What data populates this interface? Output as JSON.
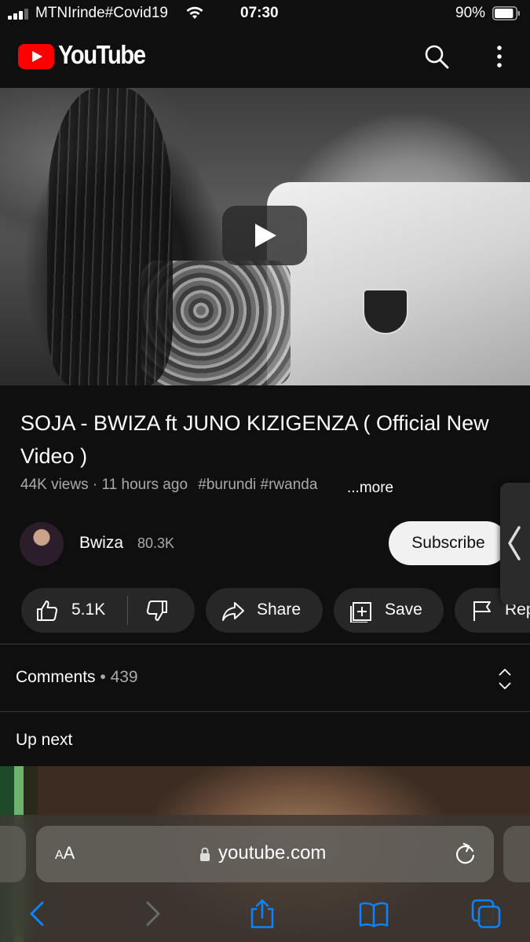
{
  "status_bar": {
    "carrier": "MTNIrinde#Covid19",
    "time": "07:30",
    "battery": "90%",
    "battery_level": 0.9
  },
  "header": {
    "brand": "YouTube",
    "icons": [
      "youtube-logo-icon",
      "search-icon",
      "more-vert-icon"
    ]
  },
  "video": {
    "title": "SOJA - BWIZA ft JUNO KIZIGENZA ( Official New Video )",
    "views": "44K views",
    "separator": "·",
    "age": "11 hours ago",
    "tags": [
      "#burundi",
      "#rwanda"
    ],
    "more": "...more"
  },
  "channel": {
    "name": "Bwiza",
    "subscribers": "80.3K",
    "subscribe_label": "Subscribe"
  },
  "actions": {
    "likes": "5.1K",
    "share": "Share",
    "save": "Save",
    "report": "Rep"
  },
  "comments": {
    "label": "Comments",
    "dot": "•",
    "count": "439"
  },
  "up_next": {
    "label": "Up next"
  },
  "safari": {
    "aa_small": "A",
    "aa_large": "A",
    "url": "youtube.com",
    "icons": [
      "back-icon",
      "forward-icon",
      "share-icon",
      "bookmarks-icon",
      "tabs-icon"
    ]
  },
  "colors": {
    "background": "#0f0f0f",
    "youtube_red": "#ff0000",
    "safari_blue": "#0a84ff",
    "chip_bg": "#272727"
  }
}
